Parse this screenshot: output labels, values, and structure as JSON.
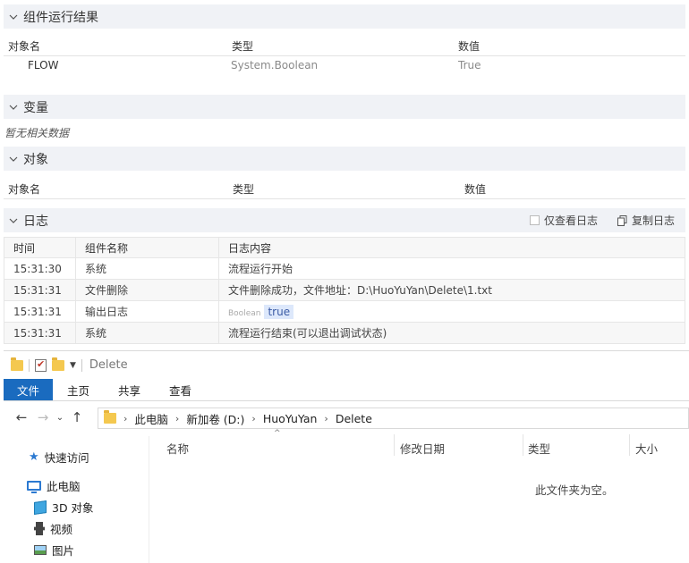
{
  "run_results": {
    "title": "组件运行结果",
    "columns": [
      "对象名",
      "类型",
      "数值"
    ],
    "rows": [
      {
        "name": "FLOW",
        "type": "System.Boolean",
        "value": "True"
      }
    ]
  },
  "variables": {
    "title": "变量",
    "empty_text": "暂无相关数据"
  },
  "objects": {
    "title": "对象",
    "columns": [
      "对象名",
      "类型",
      "数值"
    ]
  },
  "log": {
    "title": "日志",
    "view_only_label": "仅查看日志",
    "copy_label": "复制日志",
    "columns": [
      "时间",
      "组件名称",
      "日志内容"
    ],
    "rows": [
      {
        "time": "15:31:30",
        "component": "系统",
        "content": "流程运行开始"
      },
      {
        "time": "15:31:31",
        "component": "文件删除",
        "content": "文件删除成功，文件地址：D:\\HuoYuYan\\Delete\\1.txt"
      },
      {
        "time": "15:31:31",
        "component": "输出日志",
        "type_tag": "Boolean",
        "value": "true"
      },
      {
        "time": "15:31:31",
        "component": "系统",
        "content": "流程运行结束(可以退出调试状态)"
      }
    ]
  },
  "explorer": {
    "window_title": "Delete",
    "ribbon_tabs": [
      "文件",
      "主页",
      "共享",
      "查看"
    ],
    "breadcrumb": [
      "此电脑",
      "新加卷 (D:)",
      "HuoYuYan",
      "Delete"
    ],
    "nav": {
      "quick_access": "快速访问",
      "this_pc": "此电脑",
      "objects_3d": "3D 对象",
      "videos": "视频",
      "pictures": "图片"
    },
    "columns": [
      "名称",
      "修改日期",
      "类型",
      "大小"
    ],
    "empty_text": "此文件夹为空。"
  }
}
